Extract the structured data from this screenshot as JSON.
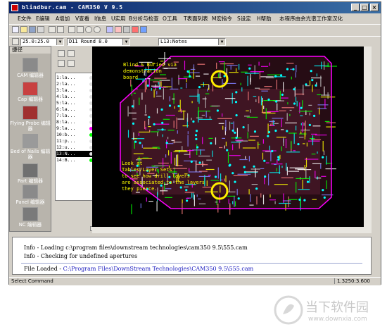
{
  "window": {
    "title": "blindbur.cam - CAM350 V 9.5",
    "controls": {
      "minimize": "_",
      "maximize": "□",
      "close": "×"
    }
  },
  "menu": [
    "E文件",
    "E编辑",
    "A增加",
    "V查看",
    "I信息",
    "U实用",
    "B分析与检查",
    "O工具",
    "T表面列表",
    "M宏指令",
    "S设定",
    "H帮助",
    "本程序由余光谱工作室汉化"
  ],
  "toolbar2": {
    "grid_combo": "25.0:25.0",
    "dcode_combo": "D11    Round 8.0",
    "layer_combo": "L13:Notes"
  },
  "left_panel": {
    "header": "捷径",
    "items": [
      {
        "label": "CAM 编辑器"
      },
      {
        "label": "Cap 编辑器"
      },
      {
        "label": "Flying Probe 编辑器"
      },
      {
        "label": "Bed of Nails 编辑器"
      },
      {
        "label": "Part 编辑器"
      },
      {
        "label": "Panel 编辑器"
      },
      {
        "label": "NC 编辑器"
      }
    ]
  },
  "layers": [
    {
      "label": "1:la...",
      "color": "#e0e0e0"
    },
    {
      "label": "2:la...",
      "color": "#e0e0e0"
    },
    {
      "label": "3:la...",
      "color": "#e0e0e0"
    },
    {
      "label": "4:la...",
      "color": "#e0e0e0"
    },
    {
      "label": "5:la...",
      "color": "#e0e0e0"
    },
    {
      "label": "6:la...",
      "color": "#e0e0e0"
    },
    {
      "label": "7:la...",
      "color": "#e0e0e0"
    },
    {
      "label": "8:la...",
      "color": "#e0e0e0"
    },
    {
      "label": "9:la...",
      "color": "#ff00ff"
    },
    {
      "label": "10:b...",
      "color": "#00ff00"
    },
    {
      "label": "11:p...",
      "color": "#e0e0e0"
    },
    {
      "label": "12:u...",
      "color": "#e0e0e0"
    },
    {
      "label": "13:N...",
      "color": "#e0e0e0"
    },
    {
      "label": "14:B...",
      "color": "#00ff00"
    }
  ],
  "canvas": {
    "note_top": [
      "Blind & Buried via",
      "demonstration",
      "board"
    ],
    "note_bottom": [
      "Look at",
      "Tables/Layer Sets",
      "to see how drill layers",
      "are associated to the layers",
      "they pierce."
    ],
    "board_outline_color": "#ff00ff",
    "text_color": "#ffff00"
  },
  "console": {
    "lines": [
      "Info - Loading c:\\program files\\downstream technologies\\cam350 9.5\\555.cam",
      "Info - Checking for undefined apertures"
    ],
    "loaded_prefix": "File Loaded - ",
    "loaded_path": "C:\\Program Files\\DownStream Technologies\\CAM350 9.5\\555.cam"
  },
  "status": {
    "left": "Select Command",
    "right": "1.3250:3.600"
  },
  "watermark": {
    "text": "当下软件园",
    "url": "www.downxia.com"
  }
}
